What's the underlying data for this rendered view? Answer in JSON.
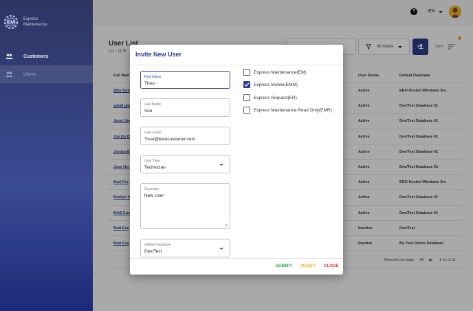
{
  "sidebar": {
    "logo_text_line1": "Express",
    "logo_text_line2": "Maintenance",
    "items": [
      {
        "label": "Customers",
        "icon": "group-icon"
      },
      {
        "label": "Users",
        "icon": "users-icon"
      }
    ]
  },
  "topbar": {
    "help_icon": "?",
    "language": "EN"
  },
  "page": {
    "title": "User List",
    "subtitle": "(11 / 11 R",
    "filter_label": "All Users",
    "sort_label": "Sort",
    "columns": [
      "Full Nam",
      "User Status",
      "Default Database"
    ],
    "rows": [
      {
        "name": "Billy Bob",
        "status": "Active",
        "db": "ERO Hosted Windows Srv"
      },
      {
        "name": "gmail gm",
        "status": "Active",
        "db": "Dev/Test Database 01"
      },
      {
        "name": "Janet Sm",
        "status": "Active",
        "db": "Dev/Test Database 01"
      },
      {
        "name": "Jim Bo B",
        "status": "Active",
        "db": "Dev/Test Database 01"
      },
      {
        "name": "Jordan B",
        "status": "Active",
        "db": "Dev/Test Database 01"
      },
      {
        "name": "Jose Her",
        "status": "Active",
        "db": "Dev/Test Database 01"
      },
      {
        "name": "Mad Pro",
        "status": "Active",
        "db": "ERO Hosted Windows Srv"
      },
      {
        "name": "Marilyn S",
        "status": "Active",
        "db": "Dev/Test Database 01"
      },
      {
        "name": "MAS Cus",
        "status": "Active",
        "db": "Dev/Test Database 01"
      },
      {
        "name": "Matt Eva",
        "status": "Inactive",
        "db": "Dev/Test"
      },
      {
        "name": "Matt Eva",
        "status": "Inactive",
        "db": "My Test Delete Database"
      }
    ],
    "rows_per_page_label": "Records per page",
    "rows_per_page_value": "All",
    "range_text": "1-11 of 11"
  },
  "modal": {
    "title": "Invite New User",
    "fields": {
      "first_name": {
        "label": "First Name",
        "value": "Theo"
      },
      "last_name": {
        "label": "Last Name",
        "value": "Vun"
      },
      "email": {
        "label": "User Email",
        "value": "Tvun@bestcustomer.com"
      },
      "user_type": {
        "label": "User Type",
        "value": "Technician"
      },
      "summary": {
        "label": "Summary",
        "value": "New User"
      },
      "default_db": {
        "label": "Default Database",
        "value": "Dev/Test"
      }
    },
    "products": [
      {
        "label": "Express Maintenance(EM)",
        "checked": false
      },
      {
        "label": "Express Mobile(EMM)",
        "checked": true
      },
      {
        "label": "Express Request(ER)",
        "checked": false
      },
      {
        "label": "Express Maintenance Read Only(EMR)",
        "checked": false
      }
    ],
    "actions": {
      "submit": "SUBMIT",
      "reset": "RESET",
      "close": "CLOSE"
    }
  },
  "colors": {
    "primary": "#2c3c8a",
    "submit": "#2e9e4a",
    "reset": "#e0b020",
    "close": "#e03a2e"
  }
}
